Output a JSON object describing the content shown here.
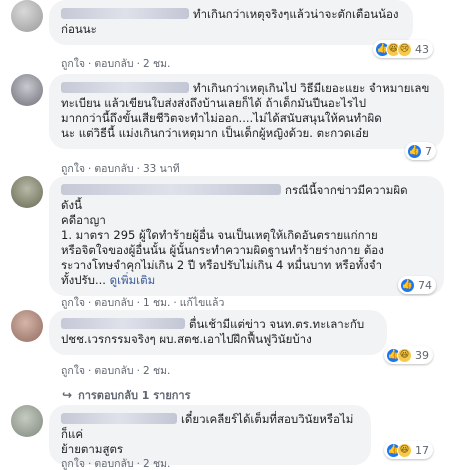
{
  "comments": [
    {
      "id": "c1",
      "text_lines": [
        "ทำเกินกว่าเหตุจริงๆแล้วน่าจะตักเตือนน้อง",
        "ก่อนนะ"
      ],
      "like": "ถูกใจ",
      "reply": "ตอบกลับ",
      "time": "2 ชม.",
      "reactions": [
        "like",
        "haha",
        "sad"
      ],
      "reaction_count": "43"
    },
    {
      "id": "c2",
      "text_lines": [
        "ทำเกินกว่าเหตุเกินไป วิธีมีเยอะแยะ จำหมายเลข",
        "ทะเบียน แล้วเขียนใบส่งส่งถึงบ้านเลยก็ได้ ถ้าเด็กมันปีนอะไรไป",
        "มากกว่านี้ถึงขั้นเสียชีวิตจะทำไม่ออก....ไม่ได้สนับสนุนให้คนทำผิด",
        "นะ แต่วิธีนี้ แม่งเกินกว่าเหตุมาก เป็นเด็กผู้หญิงด้วย. ตะกวดเอ๋ย"
      ],
      "like": "ถูกใจ",
      "reply": "ตอบกลับ",
      "time": "33 นาที",
      "reactions": [
        "like"
      ],
      "reaction_count": "7"
    },
    {
      "id": "c3",
      "text_lines": [
        "กรณีนี้จากข่าวมีความผิด ดังนี้",
        "คดีอาญา",
        "1. มาตรา 295 ผู้ใดทำร้ายผู้อื่น จนเป็นเหตุให้เกิดอันตรายแก่กาย",
        "หรือจิตใจของผู้อื่นนั้น ผู้นั้นกระทำความผิดฐานทำร้ายร่างกาย ต้อง",
        "ระวางโทษจำคุกไม่เกิน 2 ปี หรือปรับไม่เกิน 4 หมื่นบาท หรือทั้งจำ",
        "ทั้งปรับ..."
      ],
      "see_more": "ดูเพิ่มเติม",
      "like": "ถูกใจ",
      "reply": "ตอบกลับ",
      "time": "1 ชม.",
      "edited": "แก้ไขแล้ว",
      "reactions": [
        "like"
      ],
      "reaction_count": "74"
    },
    {
      "id": "c4",
      "text_lines": [
        "ตื่นเช้ามีแต่ข่าว จนท.ตร.ทะเลาะกับ",
        "ปชช.เวรกรรมจริงๆ ผบ.สตช.เอาไปฝึกฟื้นฟูวินัยบ้าง"
      ],
      "like": "ถูกใจ",
      "reply": "ตอบกลับ",
      "time": "2 ชม.",
      "reactions": [
        "like",
        "haha"
      ],
      "reaction_count": "39",
      "replies_link": "การตอบกลับ 1 รายการ"
    },
    {
      "id": "c5",
      "text_lines": [
        "เดี๋ยวเคลียร์ได้เต็มที่สอบวินัยหรือไม่ก็แค่",
        "ย้ายตามสูตร"
      ],
      "like": "ถูกใจ",
      "reply": "ตอบกลับ",
      "time": "2 ชม.",
      "reactions": [
        "like",
        "haha"
      ],
      "reaction_count": "17"
    }
  ],
  "colors": {
    "bubble": "#f2f3f5",
    "link": "#385898",
    "like": "#1877f2",
    "meta": "#606770"
  }
}
